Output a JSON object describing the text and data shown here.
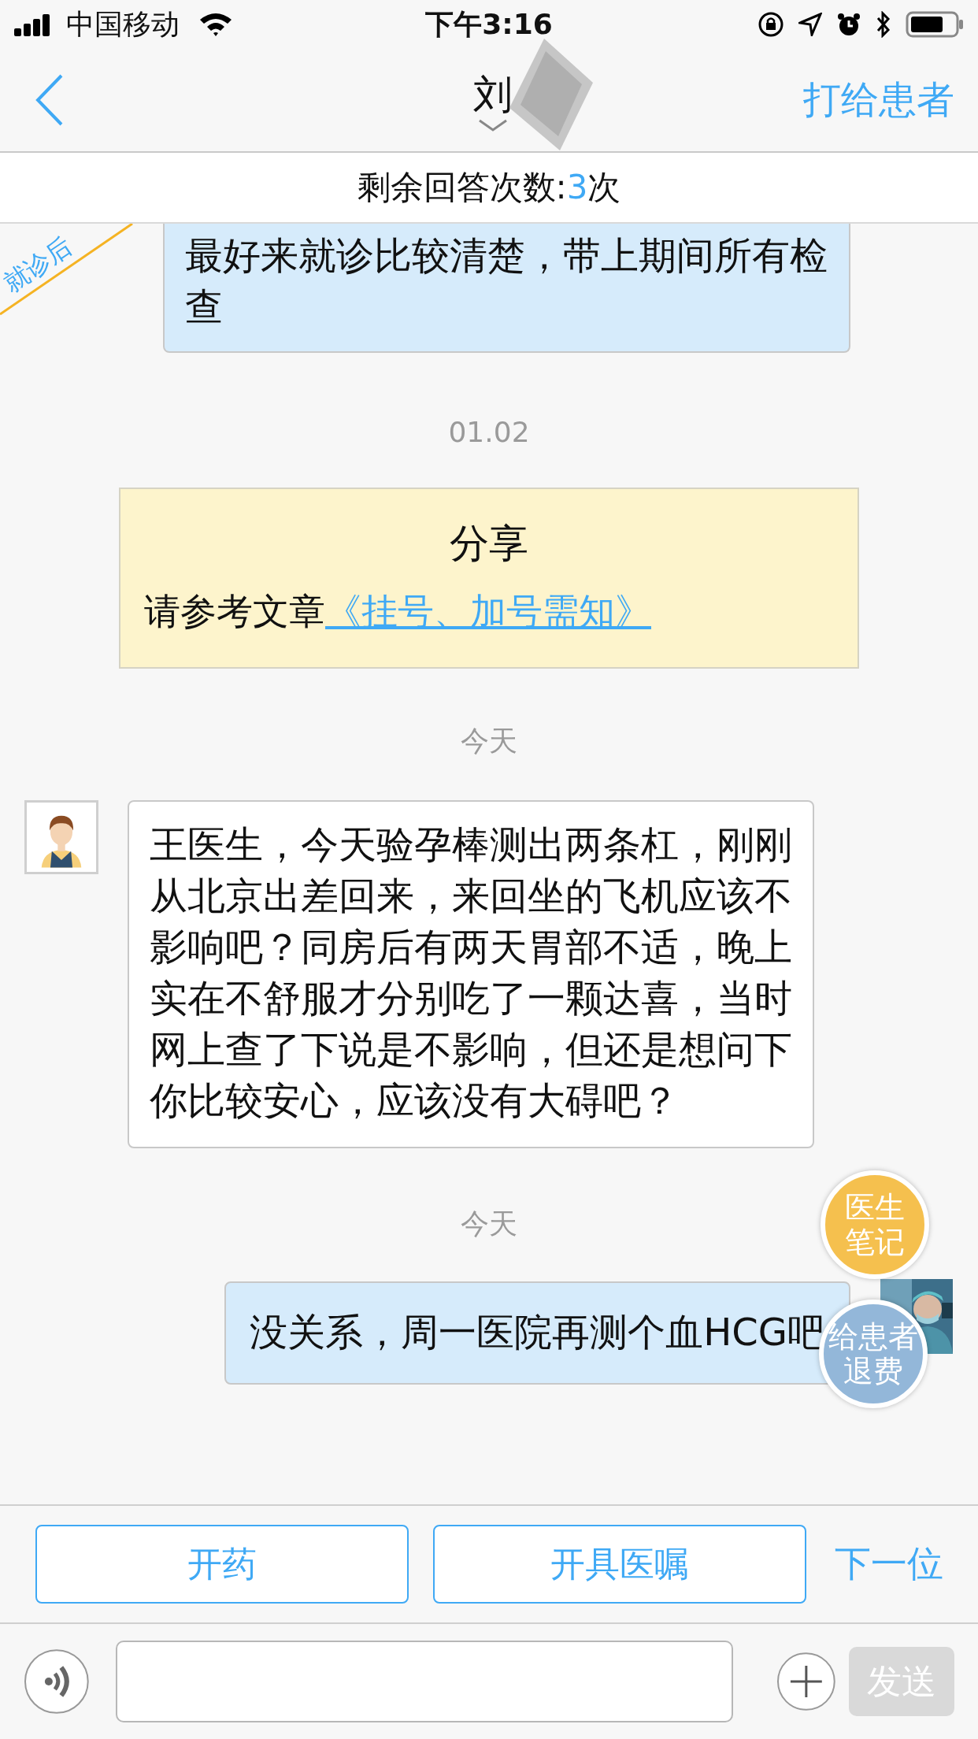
{
  "status_bar": {
    "carrier": "中国移动",
    "time": "下午3:16"
  },
  "nav": {
    "title": "刘",
    "call_button": "打给患者"
  },
  "remaining": {
    "label": "剩余回答次数:",
    "count": "3",
    "unit": "次"
  },
  "ribbon": {
    "label": "就诊后"
  },
  "messages": [
    {
      "kind": "doctor_cut",
      "text": "最好来就诊比较清楚，带上期间所有检查"
    },
    {
      "kind": "date",
      "text": "01.02"
    },
    {
      "kind": "share",
      "title": "分享",
      "text": "请参考文章",
      "link": "《挂号、加号需知》"
    },
    {
      "kind": "date",
      "text": "今天"
    },
    {
      "kind": "patient",
      "text": "王医生，今天验孕棒测出两条杠，刚刚从北京出差回来，来回坐的飞机应该不影响吧？同房后有两天胃部不适，晚上实在不舒服才分别吃了一颗达喜，当时网上查了下说是不影响，但还是想问下你比较安心，应该没有大碍吧？"
    },
    {
      "kind": "date",
      "text": "今天"
    },
    {
      "kind": "doctor",
      "text": "没关系，周一医院再测个血HCG吧"
    }
  ],
  "floating_buttons": [
    {
      "label": "医生笔记",
      "color": "#f5c04e"
    },
    {
      "label": "给患者退费",
      "color": "#93b7d9"
    }
  ],
  "actions": [
    {
      "label": "开药",
      "kind": "outlined"
    },
    {
      "label": "开具医嘱",
      "kind": "outlined"
    },
    {
      "label": "下一位",
      "kind": "link"
    }
  ],
  "composer": {
    "send": "发送",
    "send_disabled": true
  }
}
